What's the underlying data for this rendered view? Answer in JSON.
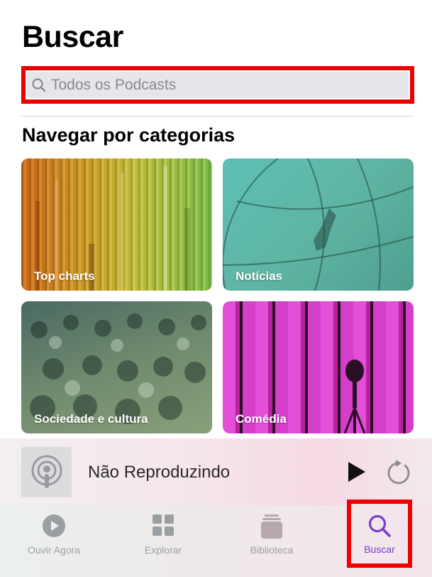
{
  "header": {
    "title": "Buscar"
  },
  "search": {
    "placeholder": "Todos os Podcasts"
  },
  "categories": {
    "section_title": "Navegar por categorias",
    "items": [
      {
        "label": "Top charts"
      },
      {
        "label": "Notícias"
      },
      {
        "label": "Sociedade e cultura"
      },
      {
        "label": "Comédia"
      }
    ]
  },
  "mini_player": {
    "status": "Não Reproduzindo"
  },
  "tabbar": {
    "items": [
      {
        "label": "Ouvir Agora",
        "icon": "play-circle-icon"
      },
      {
        "label": "Explorar",
        "icon": "grid-icon"
      },
      {
        "label": "Biblioteca",
        "icon": "library-icon"
      },
      {
        "label": "Buscar",
        "icon": "search-icon"
      }
    ],
    "active_color": "#7a3ec8",
    "inactive_color": "#9aa0a2"
  },
  "colors": {
    "highlight": "#ee0000"
  }
}
